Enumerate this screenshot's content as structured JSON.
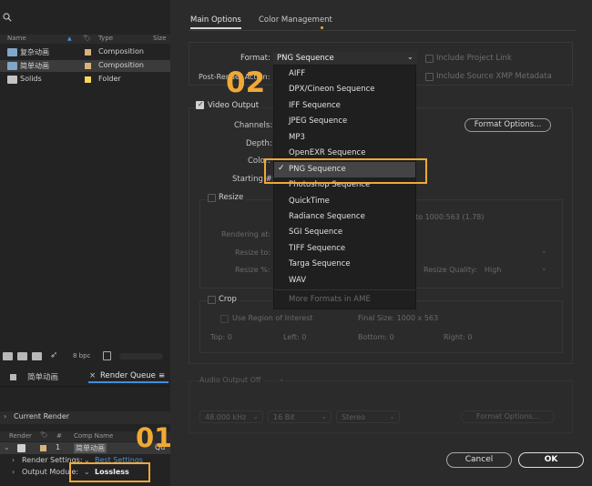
{
  "project_panel": {
    "columns": [
      "Name",
      "Type",
      "Size"
    ],
    "items": [
      {
        "name": "复杂动画",
        "type": "Composition",
        "label_color": "#d8b37d",
        "icon": "composition-icon"
      },
      {
        "name": "简单动画",
        "type": "Composition",
        "label_color": "#d8b37d",
        "icon": "composition-icon"
      },
      {
        "name": "Solids",
        "type": "Folder",
        "label_color": "#f5d75a",
        "icon": "folder-icon"
      }
    ],
    "bit_depth": "8 bpc"
  },
  "panel_tabs": {
    "comp_tab": "简单动画",
    "render_queue_close": "×",
    "render_queue_tab": "Render Queue",
    "menu_glyph": "≡"
  },
  "render_queue": {
    "section": "Current Render",
    "columns": [
      "Render",
      "#",
      "Comp Name"
    ],
    "row": {
      "number": "1",
      "comp_name": "简单动画",
      "status": "Qu"
    },
    "render_settings_label": "Render Settings:",
    "render_settings_value": "Best Settings",
    "output_module_label": "Output Module:",
    "output_module_value": "Lossless"
  },
  "annotations": {
    "step1": "01",
    "step2": "02",
    "highlight_color": "#f0a935"
  },
  "dialog": {
    "tabs": [
      "Main Options",
      "Color Management"
    ],
    "format_label": "Format:",
    "format_value": "PNG Sequence",
    "post_render_label": "Post-Render Action:",
    "include_project_link": "Include Project Link",
    "include_xmp": "Include Source XMP Metadata",
    "video_output": "Video Output",
    "channels_label": "Channels:",
    "depth_label": "Depth:",
    "color_label": "Color:",
    "starting_label": "Starting #:",
    "format_options_button": "Format Options...",
    "resize": "Resize",
    "rendering_at_label": "Rendering at:",
    "resize_to_label": "Resize to:",
    "resize_pct_label": "Resize %:",
    "ratio_text": "to 1000:563 (1.78)",
    "resize_quality_label": "Resize Quality:",
    "resize_quality_value": "High",
    "crop": "Crop",
    "use_roi": "Use Region of Interest",
    "final_size": "Final Size: 1000 x 563",
    "crop_top": "Top:  0",
    "crop_left": "Left:  0",
    "crop_bottom": "Bottom:  0",
    "crop_right": "Right:  0",
    "audio_output": "Audio Output Off",
    "audio_rate": "48.000 kHz",
    "audio_bits": "16 Bit",
    "audio_channels": "Stereo",
    "audio_format_button": "Format Options...",
    "cancel_button": "Cancel",
    "ok_button": "OK"
  },
  "format_menu": {
    "items": [
      "AIFF",
      "DPX/Cineon Sequence",
      "IFF Sequence",
      "JPEG Sequence",
      "MP3",
      "OpenEXR Sequence",
      "PNG Sequence",
      "Photoshop Sequence",
      "QuickTime",
      "Radiance Sequence",
      "SGI Sequence",
      "TIFF Sequence",
      "Targa Sequence",
      "WAV"
    ],
    "selected": "PNG Sequence",
    "more": "More Formats in AME"
  }
}
